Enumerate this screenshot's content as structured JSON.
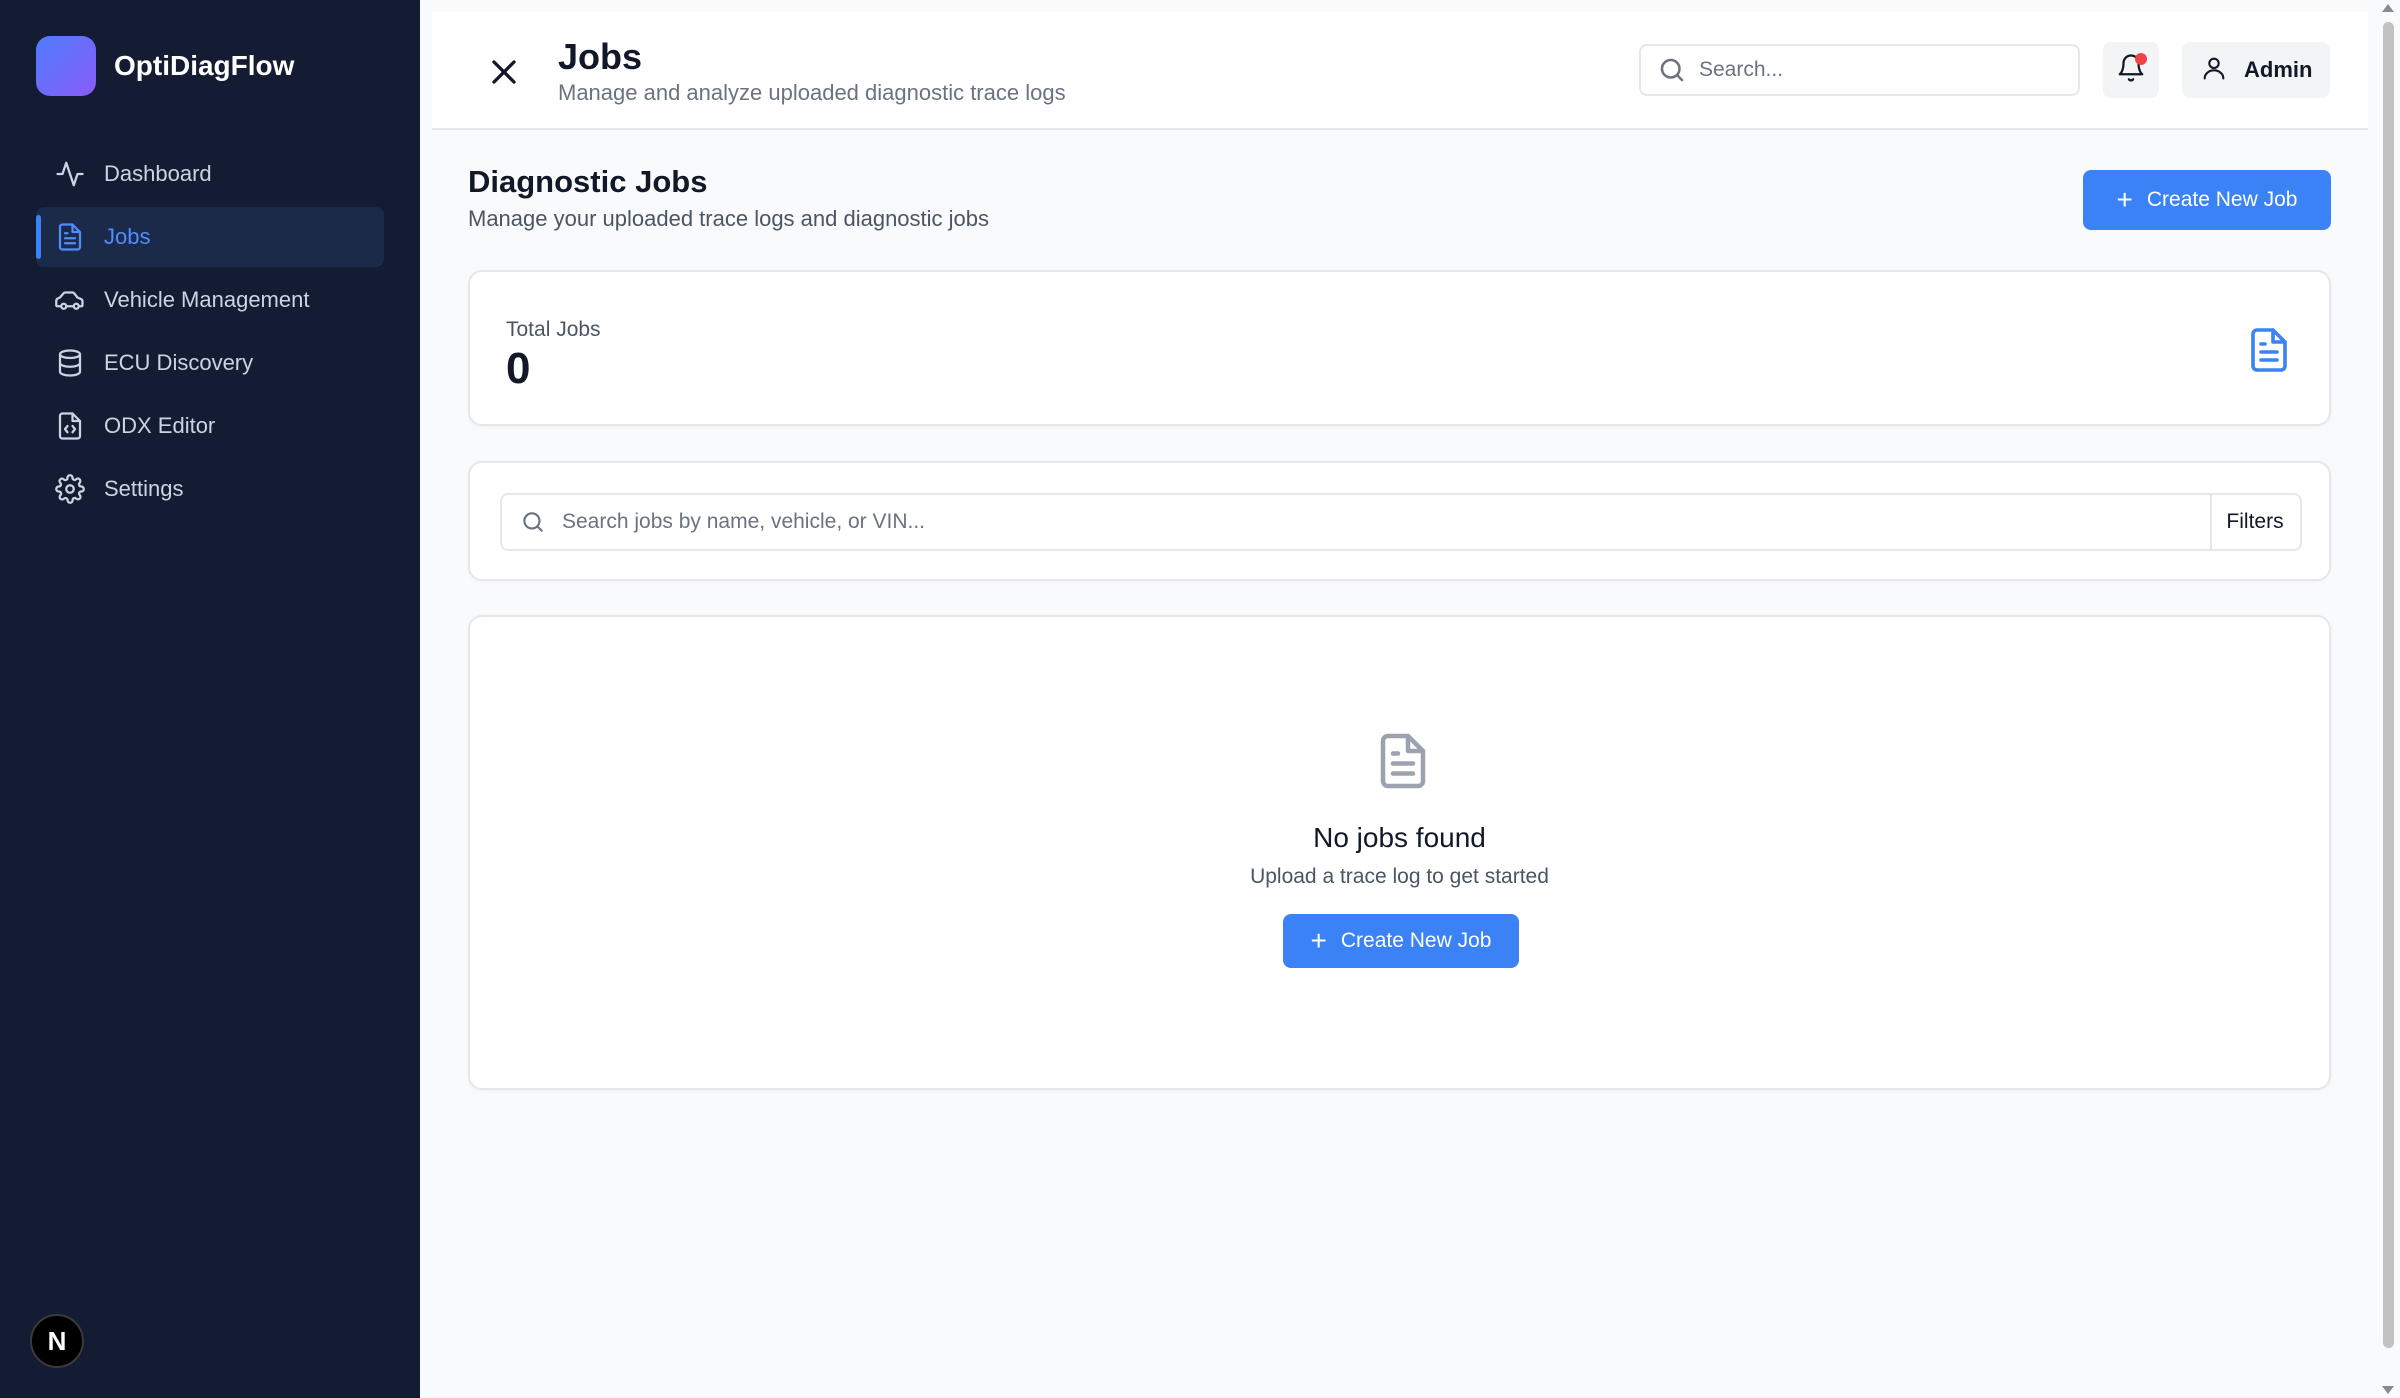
{
  "app": {
    "name": "OptiDiagFlow",
    "badge_letter": "N"
  },
  "sidebar": {
    "items": [
      {
        "label": "Dashboard",
        "icon": "activity-icon",
        "active": false
      },
      {
        "label": "Jobs",
        "icon": "file-text-icon",
        "active": true
      },
      {
        "label": "Vehicle Management",
        "icon": "car-icon",
        "active": false
      },
      {
        "label": "ECU Discovery",
        "icon": "database-icon",
        "active": false
      },
      {
        "label": "ODX Editor",
        "icon": "file-code-icon",
        "active": false
      },
      {
        "label": "Settings",
        "icon": "gear-icon",
        "active": false
      }
    ]
  },
  "header": {
    "title": "Jobs",
    "subtitle": "Manage and analyze uploaded diagnostic trace logs",
    "search_placeholder": "Search...",
    "user_label": "Admin"
  },
  "section": {
    "title": "Diagnostic Jobs",
    "subtitle": "Manage your uploaded trace logs and diagnostic jobs",
    "create_label": "Create New Job"
  },
  "stats": {
    "total_label": "Total Jobs",
    "total_value": "0"
  },
  "filters": {
    "search_placeholder": "Search jobs by name, vehicle, or VIN...",
    "filters_label": "Filters"
  },
  "empty": {
    "title": "No jobs found",
    "subtitle": "Upload a trace log to get started",
    "create_label": "Create New Job"
  },
  "colors": {
    "sidebar_bg": "#141c33",
    "accent": "#3b82f6",
    "notification_dot": "#ef4444"
  }
}
